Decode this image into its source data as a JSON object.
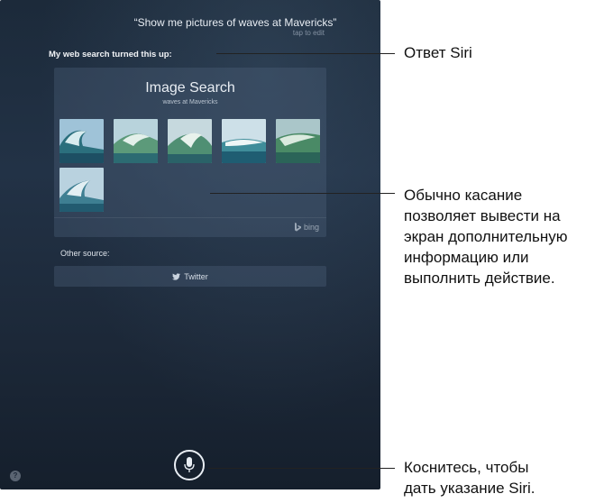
{
  "siri": {
    "query": "“Show me pictures of waves at Mavericks”",
    "tap_to_edit": "tap to edit",
    "heading": "My web search turned this up:",
    "panel": {
      "title": "Image Search",
      "subtitle": "waves at Mavericks",
      "thumbnails": [
        "wave-image",
        "wave-image",
        "wave-image",
        "wave-image",
        "wave-image",
        "wave-image"
      ],
      "provider": "bing"
    },
    "other_source_label": "Other source:",
    "twitter_label": "Twitter",
    "help_label": "?"
  },
  "callouts": {
    "siri_response": "Ответ Siri",
    "tap_info": [
      "Обычно касание",
      "позволяет вывести на",
      "экран дополнительную",
      "информацию или",
      "выполнить действие."
    ],
    "mic_tip": [
      "Коснитесь, чтобы",
      "дать указание Siri."
    ]
  },
  "colors": {
    "background": "#1c2a3a",
    "panel": "#3d4f63",
    "text": "#e8edf3"
  }
}
